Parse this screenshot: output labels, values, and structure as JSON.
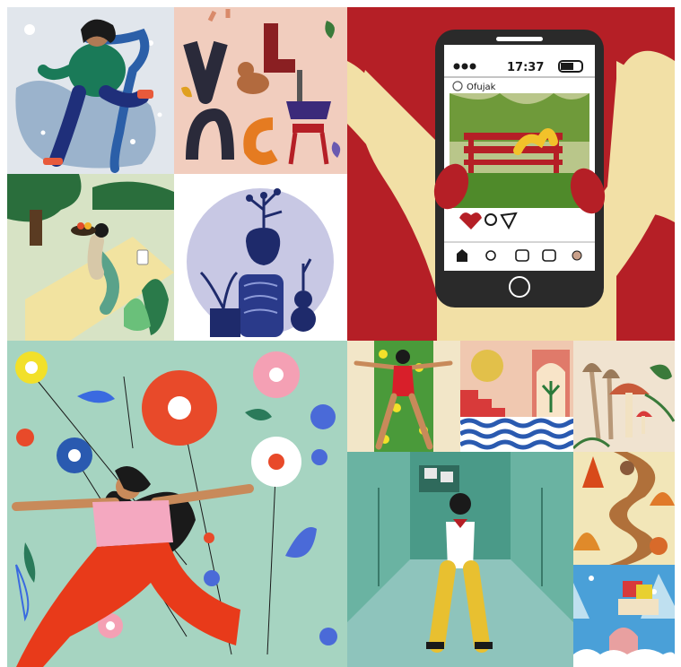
{
  "phone": {
    "time": "17:37",
    "username": "Ofujak"
  },
  "tiles": [
    {
      "id": "skater",
      "icon": "person-skating-in-snow"
    },
    {
      "id": "letters",
      "icon": "letters-with-dog-and-cat"
    },
    {
      "id": "phone",
      "icon": "hands-holding-phone"
    },
    {
      "id": "picnic",
      "icon": "person-lying-on-picnic-blanket"
    },
    {
      "id": "vases",
      "icon": "vases-with-plants"
    },
    {
      "id": "flowers",
      "icon": "woman-stretching-among-flowers"
    },
    {
      "id": "swimmer",
      "icon": "woman-in-red-swimsuit"
    },
    {
      "id": "pool",
      "icon": "sea-and-arch-with-plant"
    },
    {
      "id": "mushrooms",
      "icon": "mushrooms-and-ferns"
    },
    {
      "id": "hallway",
      "icon": "woman-in-school-hallway"
    },
    {
      "id": "autumn",
      "icon": "autumn-road"
    },
    {
      "id": "winter",
      "icon": "winter-gifts"
    }
  ],
  "colors": {
    "red": "#b51f26",
    "mint": "#a6d4c1",
    "teal": "#5aa696",
    "cream": "#f0e3b0",
    "navy": "#1e2a6b"
  }
}
